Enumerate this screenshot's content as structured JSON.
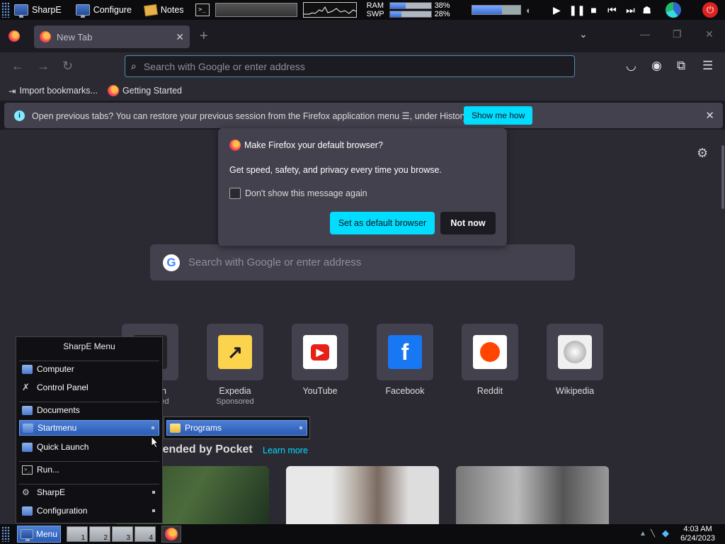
{
  "topbar": {
    "items": [
      "SharpE",
      "Configure",
      "Notes"
    ],
    "ram_label": "RAM",
    "swp_label": "SWP",
    "ram_value": "38%",
    "swp_value": "28%",
    "ram_fraction": 0.38,
    "swp_fraction": 0.28,
    "volume_fraction": 0.62,
    "media_buttons": [
      "play-icon",
      "pause-icon",
      "stop-icon",
      "previous-icon",
      "next-icon"
    ]
  },
  "browser": {
    "tab_title": "New Tab",
    "url_placeholder": "Search with Google or enter address",
    "bookmarks": [
      "Import bookmarks...",
      "Getting Started"
    ],
    "notification": {
      "text": "Open previous tabs? You can restore your previous session from the Firefox application menu",
      "text_after": ", under History.",
      "button": "Show me how"
    },
    "dialog": {
      "title": "Make Firefox your default browser?",
      "body": "Get speed, safety, and privacy every time you browse.",
      "checkbox": "Don't show this message again",
      "primary": "Set as default browser",
      "secondary": "Not now"
    },
    "search_placeholder": "Search with Google or enter address",
    "shortcuts": [
      {
        "name": "Amazon",
        "sub": "Sponsored",
        "color": "#111"
      },
      {
        "name": "Expedia",
        "sub": "Sponsored",
        "color": "#fcd34d"
      },
      {
        "name": "YouTube",
        "sub": "",
        "color": "#ffffff"
      },
      {
        "name": "Facebook",
        "sub": "",
        "color": "#1877f2"
      },
      {
        "name": "Reddit",
        "sub": "",
        "color": "#ffffff"
      },
      {
        "name": "Wikipedia",
        "sub": "",
        "color": "#f0f0f0"
      }
    ],
    "pocket_title": "Recommended by Pocket",
    "pocket_link": "Learn more"
  },
  "sharpe_menu": {
    "title": "SharpE Menu",
    "items": [
      "Computer",
      "Control Panel",
      "Documents",
      "Startmenu",
      "Quick Launch",
      "Run...",
      "SharpE",
      "Configuration"
    ],
    "submenu_item": "Programs"
  },
  "bottombar": {
    "menu_label": "Menu",
    "workspaces": [
      "1",
      "2",
      "3",
      "4"
    ],
    "time": "4:03 AM",
    "date": "6/24/2023"
  }
}
